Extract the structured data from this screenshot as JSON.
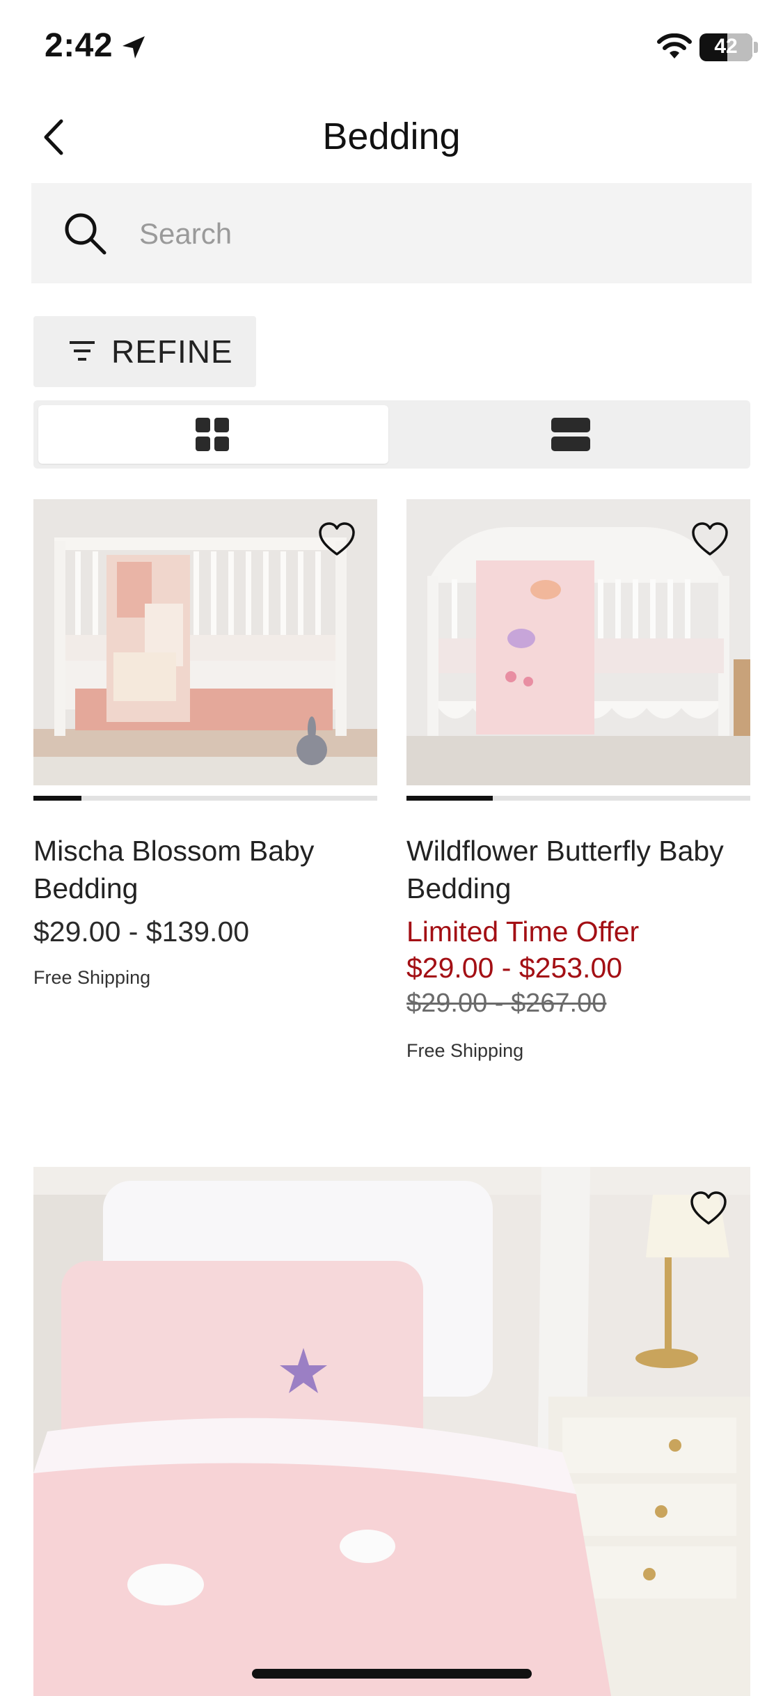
{
  "status_bar": {
    "time": "2:42",
    "battery": "42"
  },
  "header": {
    "title": "Bedding",
    "back_icon": "chevron-left-icon"
  },
  "search": {
    "placeholder": "Search",
    "value": "",
    "icon": "search-icon"
  },
  "refine": {
    "label": "REFINE",
    "icon": "filter-icon"
  },
  "view_toggle": {
    "selected": "grid",
    "options": [
      "grid",
      "list"
    ]
  },
  "products": [
    {
      "name": "Mischa Blossom Baby Bedding",
      "price": "$29.00 - $139.00",
      "shipping": "Free Shipping",
      "carousel_progress": 0.14
    },
    {
      "name": "Wildflower Butterfly Baby Bedding",
      "offer": "Limited Time Offer",
      "sale_price": "$29.00 - $253.00",
      "original_price": "$29.00 - $267.00",
      "shipping": "Free Shipping",
      "carousel_progress": 0.25
    }
  ],
  "colors": {
    "sale": "#a30f14",
    "text": "#222222",
    "surface": "#f3f3f3"
  }
}
